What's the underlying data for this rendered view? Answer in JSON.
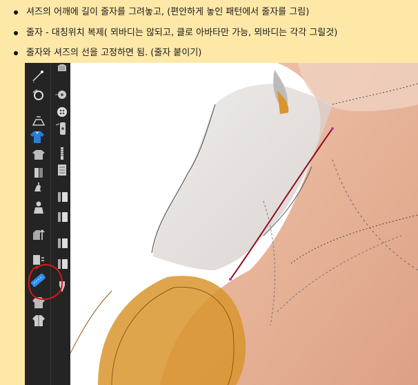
{
  "notes": [
    "셔즈의 어깨에 길이 줄자를 그려놓고, (편안하게 놓인 패턴에서 줄자를 그림)",
    "줄자 - 대칭위치 복제( 뫼바디는 않되고, 클로 아바타만 가능, 뫼바디는 각각 그릴것)",
    "줄자와 셔즈의 선을 고정하면 됨. (줄자 붙이기)"
  ],
  "toolbar_icons": [
    "garment-icon",
    "pen-icon",
    "point-icon",
    "sewing-icon",
    "transform-icon",
    "button-icon",
    "avatar-tool-icon",
    "zipper-icon",
    "shirt-icon",
    "zipper-slider-icon",
    "fold-icon",
    "fold-arrange-icon",
    "pin-icon",
    "lock-icon",
    "avatar-icon",
    "measure-icon",
    "tape-measure-icon",
    "marker-icon",
    "shirt-edit-icon",
    "shirt-select-icon"
  ],
  "colors": {
    "note_background": "#fde8a8",
    "toolbar": "#242424",
    "skin": "#e8b69c",
    "tape_line": "#8b1020",
    "highlight_circle": "#d81818",
    "orange_fabric": "#d9952e"
  }
}
